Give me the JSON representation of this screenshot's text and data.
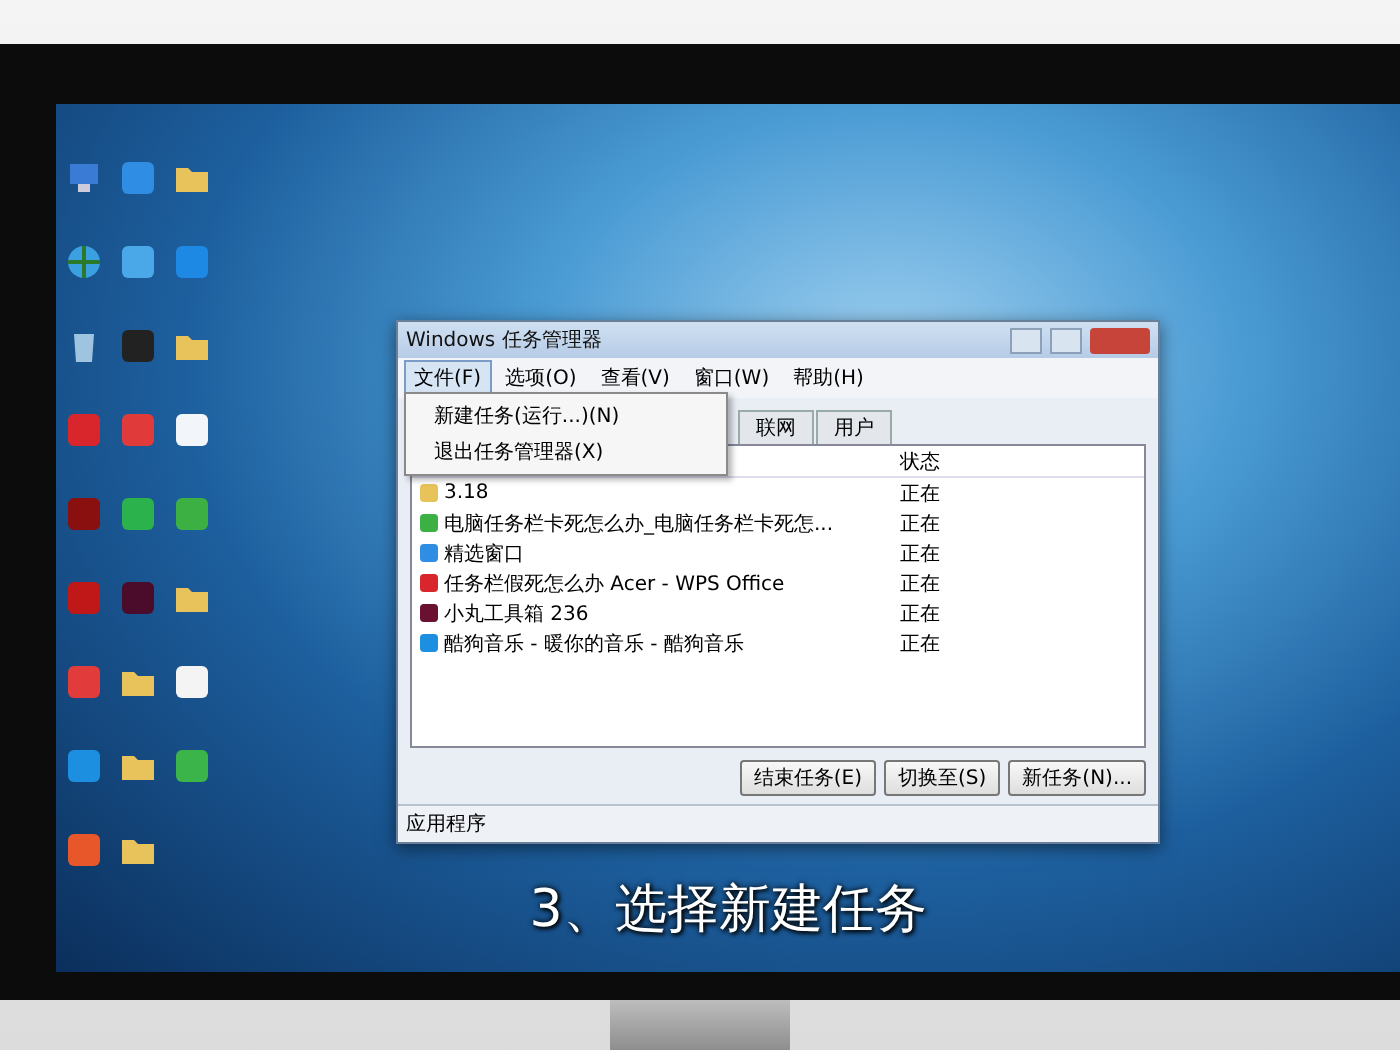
{
  "desktop": {
    "icons": [
      {
        "kind": "computer",
        "color": "#3a7bd5"
      },
      {
        "kind": "app",
        "color": "#2f8de4"
      },
      {
        "kind": "folder",
        "color": "#e8c25a"
      },
      {
        "kind": "globe",
        "color": "#3aa0e0"
      },
      {
        "kind": "app",
        "color": "#4aa8e8"
      },
      {
        "kind": "app",
        "color": "#1e88e5"
      },
      {
        "kind": "bin",
        "color": "#9fc4e0"
      },
      {
        "kind": "app",
        "color": "#222222"
      },
      {
        "kind": "folder",
        "color": "#e8c25a"
      },
      {
        "kind": "app",
        "color": "#d8262c"
      },
      {
        "kind": "app",
        "color": "#e03a3a"
      },
      {
        "kind": "app",
        "color": "#f2f6fa"
      },
      {
        "kind": "app",
        "color": "#8a1010"
      },
      {
        "kind": "app",
        "color": "#2bb24c"
      },
      {
        "kind": "app",
        "color": "#3cb043"
      },
      {
        "kind": "app",
        "color": "#c01818"
      },
      {
        "kind": "app",
        "color": "#4a0c2a"
      },
      {
        "kind": "folder",
        "color": "#e8c25a"
      },
      {
        "kind": "app",
        "color": "#e23b3b"
      },
      {
        "kind": "folder",
        "color": "#e8c25a"
      },
      {
        "kind": "app",
        "color": "#f4f4f4"
      },
      {
        "kind": "app",
        "color": "#1c8fe0"
      },
      {
        "kind": "folder",
        "color": "#e8c25a"
      },
      {
        "kind": "app",
        "color": "#3bb54a"
      },
      {
        "kind": "app",
        "color": "#e8572a"
      },
      {
        "kind": "folder",
        "color": "#e8c25a"
      }
    ]
  },
  "window": {
    "title": "Windows 任务管理器",
    "menu": [
      {
        "label": "文件(F)",
        "selected": true
      },
      {
        "label": "选项(O)",
        "selected": false
      },
      {
        "label": "查看(V)",
        "selected": false
      },
      {
        "label": "窗口(W)",
        "selected": false
      },
      {
        "label": "帮助(H)",
        "selected": false
      }
    ],
    "dropdown": [
      "新建任务(运行...)(N)",
      "退出任务管理器(X)"
    ],
    "tabs": [
      {
        "label": "联网",
        "selected": false
      },
      {
        "label": "用户",
        "selected": false
      }
    ],
    "table": {
      "columns": [
        "状态"
      ],
      "rows": [
        {
          "task": "3.18",
          "status": "正在",
          "color": "#e8c25a"
        },
        {
          "task": "电脑任务栏卡死怎么办_电脑任务栏卡死怎...",
          "status": "正在",
          "color": "#3cb043"
        },
        {
          "task": "精选窗口",
          "status": "正在",
          "color": "#2f8de4"
        },
        {
          "task": "任务栏假死怎么办 Acer - WPS Office",
          "status": "正在",
          "color": "#d8262c"
        },
        {
          "task": "小丸工具箱 236",
          "status": "正在",
          "color": "#6a1030"
        },
        {
          "task": "酷狗音乐 - 暖你的音乐 - 酷狗音乐",
          "status": "正在",
          "color": "#1c8fe0"
        }
      ]
    },
    "buttons": [
      "结束任务(E)",
      "切换至(S)",
      "新任务(N)..."
    ],
    "status_bar": "应用程序"
  },
  "caption": "3、选择新建任务"
}
